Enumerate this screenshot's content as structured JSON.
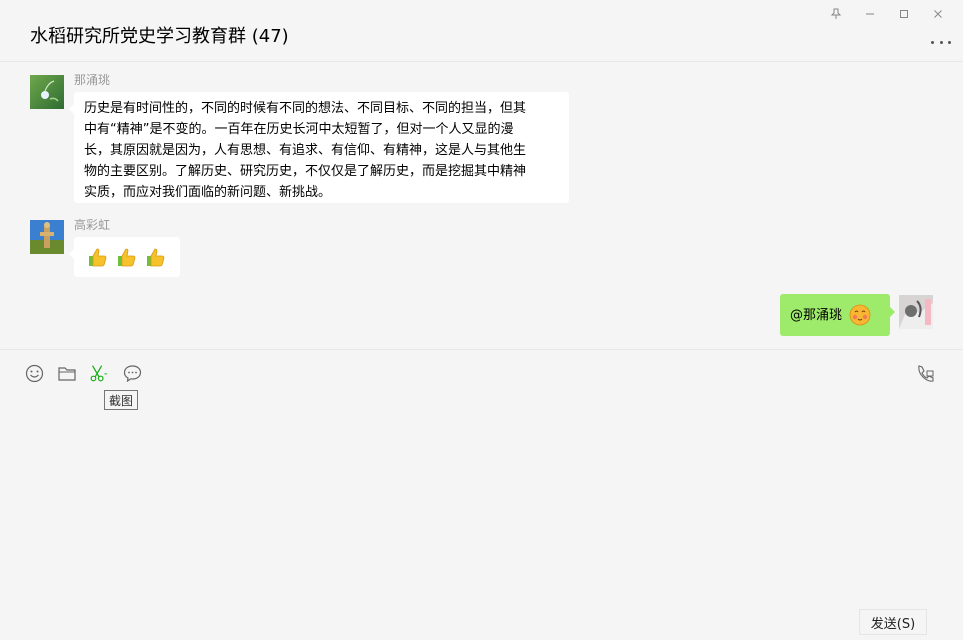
{
  "window": {
    "pin_icon": "pin-icon",
    "minimize_icon": "minimize-icon",
    "maximize_icon": "maximize-icon",
    "close_icon": "close-icon"
  },
  "header": {
    "title": "水稻研究所党史学习教育群 (47)",
    "more_icon": "more-icon"
  },
  "messages": [
    {
      "sender": "那涌珧",
      "direction": "in",
      "text_lines": [
        "历史是有时间性的，不同的时候有不同的想法、不同目标、不同的担当，但其",
        "中有“精神”是不变的。一百年在历史长河中太短暂了，但对一个人又显的漫",
        "长，其原因就是因为，人有思想、有追求、有信仰、有精神，这是人与其他生",
        "物的主要区别。了解历史、研究历史，不仅仅是了解历史，而是挖掘其中精神",
        "实质，而应对我们面临的新问题、新挑战。"
      ]
    },
    {
      "sender": "高彩虹",
      "direction": "in",
      "emojis": [
        "thumbs-up",
        "thumbs-up",
        "thumbs-up"
      ]
    },
    {
      "sender": "",
      "direction": "out",
      "text": "@那涌珧",
      "emoji": "blush-face"
    }
  ],
  "toolbar": {
    "items": [
      "emoji-icon",
      "folder-icon",
      "scissors-icon",
      "chat-history-icon"
    ],
    "tooltip": "截图",
    "call_icon": "video-call-icon"
  },
  "input": {
    "value": ""
  },
  "send_button": {
    "label": "发送(S)"
  },
  "colors": {
    "background": "#f5f5f5",
    "bubble_in": "#ffffff",
    "bubble_out": "#9eea6a",
    "accent": "#1aad19"
  }
}
